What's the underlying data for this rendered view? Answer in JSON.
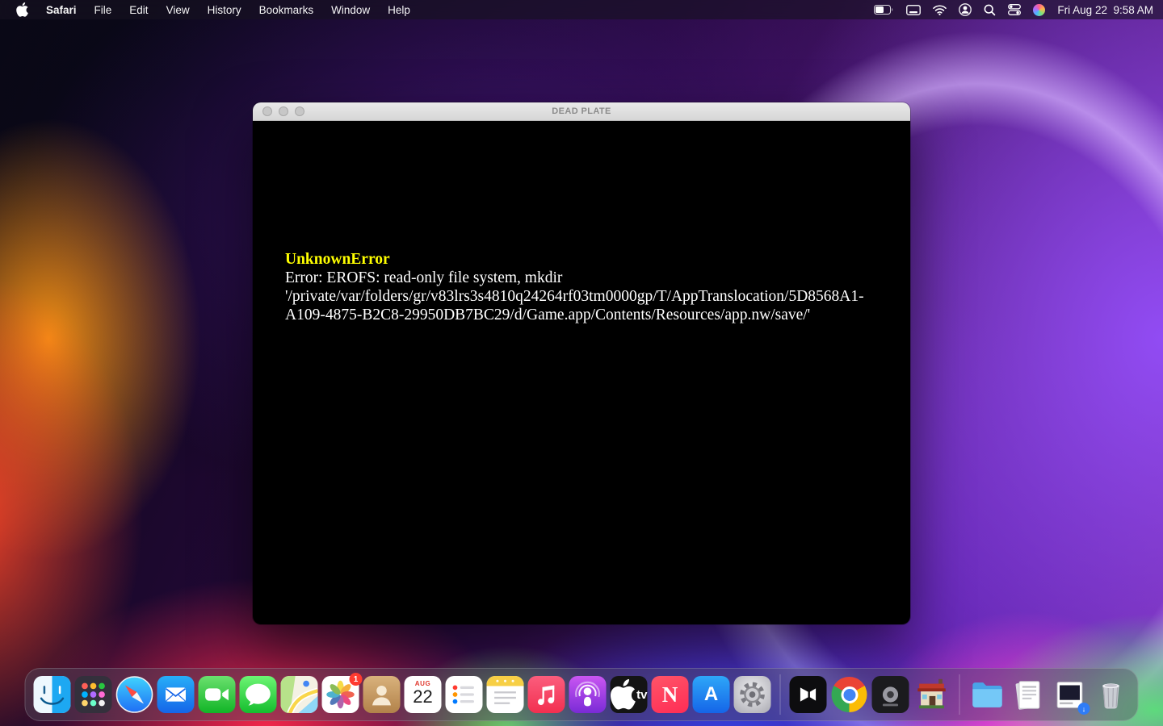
{
  "menubar": {
    "app_menu_items": [
      "Safari",
      "File",
      "Edit",
      "View",
      "History",
      "Bookmarks",
      "Window",
      "Help"
    ],
    "clock": "Fri Aug 22  9:58 AM",
    "status_icons": [
      "battery-icon",
      "display-icon",
      "wifi-icon",
      "user-switch-icon",
      "spotlight-icon",
      "control-center-icon",
      "colorful-app-icon"
    ]
  },
  "window": {
    "title": "DEAD PLATE",
    "error": {
      "title": "UnknownError",
      "body": "Error: EROFS: read-only file system, mkdir '/private/var/folders/gr/v83lrs3s4810q24264rf03tm0000gp/T/AppTranslocation/5D8568A1-A109-4875-B2C8-29950DB7BC29/d/Game.app/Contents/Resources/app.nw/save/'"
    },
    "colors": {
      "error_title": "#ffff00",
      "error_body": "#ffffff",
      "content_background": "#000000",
      "titlebar": "#dddddd"
    }
  },
  "dock": {
    "apps": [
      "Finder",
      "Launchpad",
      "Safari",
      "Mail",
      "FaceTime",
      "Messages",
      "Maps",
      "Photos",
      "Contacts",
      "Calendar",
      "Reminders",
      "Notes",
      "Music",
      "Podcasts",
      "TV",
      "News",
      "App Store",
      "System Settings",
      "CapCut",
      "Chrome",
      "Unknown App",
      "Dead Plate Game",
      "Folder",
      "Documents Stack",
      "Downloads Stack",
      "Trash"
    ],
    "photos_badge": "1",
    "calendar": {
      "month": "AUG",
      "day": "22"
    },
    "tv_label": "tv",
    "news_label": "N",
    "appstore_label": "A",
    "badge_color": "#ff3b30"
  }
}
